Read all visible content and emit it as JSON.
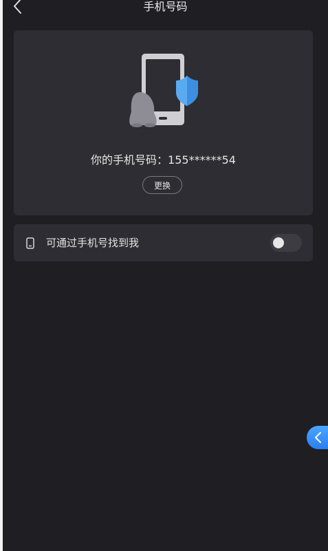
{
  "header": {
    "title": "手机号码",
    "back_icon": "chevron-left-icon"
  },
  "card": {
    "illustration": "phone-shield-penguin-illustration",
    "phone_label": "你的手机号码：155******54",
    "change_label": "更换"
  },
  "settings": {
    "find_me_label": "可通过手机号找到我",
    "find_me_icon": "mobile-phone-icon",
    "find_me_enabled": false
  },
  "float_button": {
    "icon": "chevron-left-icon"
  },
  "colors": {
    "background": "#1f1e23",
    "card": "#2e2d33",
    "accent": "#2b7ff0",
    "shield": "#5aaaf0"
  }
}
